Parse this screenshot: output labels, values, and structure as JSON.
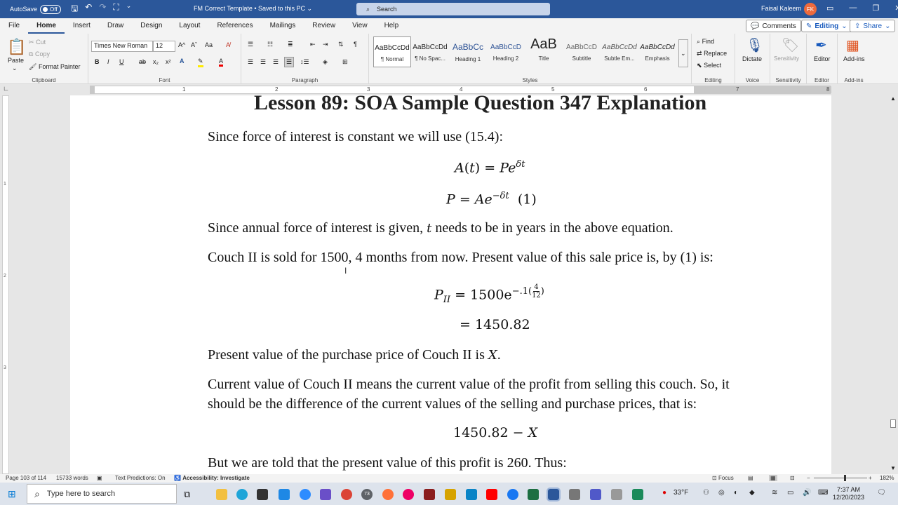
{
  "titlebar": {
    "autosave": "AutoSave",
    "toggle": "Off",
    "doc_title": "FM Correct Template • Saved to this PC ⌄",
    "search": "Search",
    "user": "Faisal Kaleem",
    "initials": "FK"
  },
  "menu": {
    "items": [
      "File",
      "Home",
      "Insert",
      "Draw",
      "Design",
      "Layout",
      "References",
      "Mailings",
      "Review",
      "View",
      "Help"
    ],
    "comments": "Comments",
    "editing": "Editing",
    "share": "Share"
  },
  "ribbon": {
    "clipboard": {
      "paste": "Paste",
      "cut": "Cut",
      "copy": "Copy",
      "format_painter": "Format Painter",
      "label": "Clipboard"
    },
    "font": {
      "name": "Times New Roman",
      "size": "12",
      "grow": "A^",
      "shrink": "Aˇ",
      "case": "Aa",
      "bold": "B",
      "italic": "I",
      "underline": "U",
      "strike": "ab",
      "subscript": "x₂",
      "superscript": "x²",
      "label": "Font"
    },
    "paragraph": {
      "label": "Paragraph"
    },
    "styles": {
      "items": [
        {
          "sample": "AaBbCcDd",
          "name": "¶ Normal"
        },
        {
          "sample": "AaBbCcDd",
          "name": "¶ No Spac..."
        },
        {
          "sample": "AaBbCc",
          "name": "Heading 1"
        },
        {
          "sample": "AaBbCcD",
          "name": "Heading 2"
        },
        {
          "sample": "AaB",
          "name": "Title"
        },
        {
          "sample": "AaBbCcD",
          "name": "Subtitle"
        },
        {
          "sample": "AaBbCcDd",
          "name": "Subtle Em..."
        },
        {
          "sample": "AaBbCcDd",
          "name": "Emphasis"
        }
      ],
      "label": "Styles"
    },
    "editing": {
      "find": "Find",
      "replace": "Replace",
      "select": "Select",
      "label": "Editing"
    },
    "voice": {
      "dictate": "Dictate",
      "label": "Voice"
    },
    "sensitivity": {
      "button": "Sensitivity",
      "label": "Sensitivity"
    },
    "editor": {
      "button": "Editor",
      "label": "Editor"
    },
    "addins": {
      "button": "Add-ins",
      "label": "Add-ins"
    }
  },
  "ruler": {
    "numbers": [
      "1",
      "2",
      "3",
      "4",
      "5",
      "6",
      "7",
      "8"
    ],
    "vertical": [
      "1",
      "2",
      "3"
    ]
  },
  "document": {
    "title": "Lesson 89:  SOA Sample Question 347 Explanation",
    "p1": "Since force of interest is constant we will use (15.4):",
    "eq1_lhs": "A",
    "eq1_t": "t",
    "eq1_rhs": "Pe",
    "eq1_sup": "δt",
    "eq2_lhs": "P",
    "eq2_rhs": "Ae",
    "eq2_sup": "−δt",
    "eq2_tag": "(1)",
    "p2a": "Since annual force of interest is given,",
    "p2_t": "t",
    "p2b": "needs to be in years in the above equation.",
    "p3": "Couch II is sold for 1500, 4 months from now.  Present value of this sale price is, by (1) is:",
    "eq3_P": "P",
    "eq3_sub": "II",
    "eq3_rhs": "1500e",
    "eq3_sup": "−.1",
    "eq3_num": "4",
    "eq3_den": "12",
    "eq4": "= 1450.82",
    "p4": "Present value of the purchase price of Couch II is",
    "p4_x": "X",
    "p5a": "Current value of Couch II means the current value of the profit from selling this couch. So, it",
    "p5b": "should be the difference of the current values of the selling and purchase prices, that is:",
    "eq5": "1450.82 −",
    "eq5_x": "X",
    "p6": "But we are told that the present value of this profit is 260.  Thus:"
  },
  "status": {
    "page": "Page 103 of 114",
    "words": "15733 words",
    "predictions": "Text Predictions: On",
    "accessibility": "Accessibility: Investigate",
    "focus": "Focus",
    "zoom": "182%"
  },
  "taskbar": {
    "search": "Type here to search",
    "badge": "73",
    "temp": "33°F",
    "time": "7:37 AM",
    "date": "12/20/2023"
  },
  "colors": {
    "word_blue": "#2b579a",
    "accent": "#185abd"
  }
}
